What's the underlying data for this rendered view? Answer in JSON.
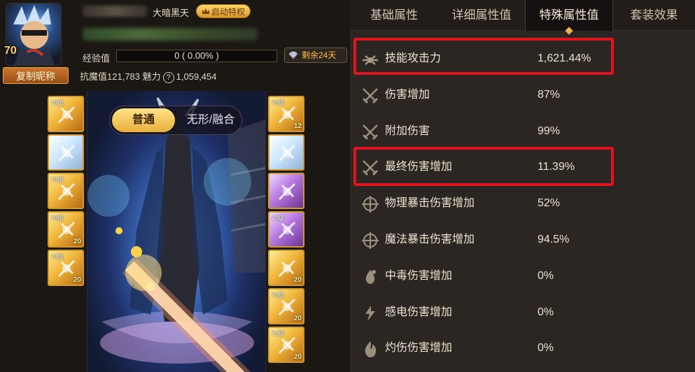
{
  "profile": {
    "level": "70",
    "guild_name": "大暗黑天",
    "privilege_label": "启动特权",
    "copy_nickname_label": "复制昵称",
    "exp_label": "经验值",
    "exp_value": "0 ( 0.00% )",
    "exp_fraction": 0,
    "remaining_label": "剩余24天",
    "anti_magic_label": "抗魔值",
    "anti_magic_value": "121,783",
    "charm_label": "魅力",
    "help_glyph": "?",
    "charm_value": "1,059,454"
  },
  "mode": {
    "normal_label": "普通",
    "fusion_label": "无形/融合"
  },
  "equipment": {
    "left": [
      {
        "level": "70级",
        "plus": "",
        "style": "gold"
      },
      {
        "level": "",
        "plus": "",
        "style": "white"
      },
      {
        "level": "70级",
        "plus": "",
        "style": "gold"
      },
      {
        "level": "70级",
        "plus": "20",
        "style": "gold"
      },
      {
        "level": "70级",
        "plus": "20",
        "style": "gold"
      }
    ],
    "right": [
      {
        "level": "70级",
        "plus": "12",
        "style": "gold"
      },
      {
        "level": "",
        "plus": "",
        "style": "white"
      },
      {
        "level": "",
        "plus": "",
        "style": "purple"
      },
      {
        "level": "70级",
        "plus": "",
        "style": "purple"
      },
      {
        "level": "",
        "plus": "20",
        "style": "gold"
      },
      {
        "level": "70级",
        "plus": "20",
        "style": "gold"
      },
      {
        "level": "70级",
        "plus": "20",
        "style": "gold"
      }
    ]
  },
  "tabs": [
    {
      "label": "基础属性",
      "active": false
    },
    {
      "label": "详细属性值",
      "active": false
    },
    {
      "label": "特殊属性值",
      "active": true
    },
    {
      "label": "套装效果",
      "active": false
    }
  ],
  "attributes": [
    {
      "icon": "skill-attack-icon",
      "label": "技能攻击力",
      "value": "1,621.44%",
      "highlighted": true
    },
    {
      "icon": "crossed-swords-icon",
      "label": "伤害增加",
      "value": "87%",
      "highlighted": false
    },
    {
      "icon": "crossed-swords-icon",
      "label": "附加伤害",
      "value": "99%",
      "highlighted": false
    },
    {
      "icon": "crossed-swords-icon",
      "label": "最终伤害增加",
      "value": "11.39%",
      "highlighted": true
    },
    {
      "icon": "crosshair-icon",
      "label": "物理暴击伤害增加",
      "value": "52%",
      "highlighted": false
    },
    {
      "icon": "crosshair-icon",
      "label": "魔法暴击伤害增加",
      "value": "94.5%",
      "highlighted": false
    },
    {
      "icon": "poison-icon",
      "label": "中毒伤害增加",
      "value": "0%",
      "highlighted": false
    },
    {
      "icon": "lightning-icon",
      "label": "感电伤害增加",
      "value": "0%",
      "highlighted": false
    },
    {
      "icon": "flame-icon",
      "label": "灼伤伤害增加",
      "value": "0%",
      "highlighted": false
    }
  ],
  "colors": {
    "highlight_box": "#e0141e",
    "accent_gold": "#f0b54a",
    "panel_bg": "#2b2621"
  }
}
